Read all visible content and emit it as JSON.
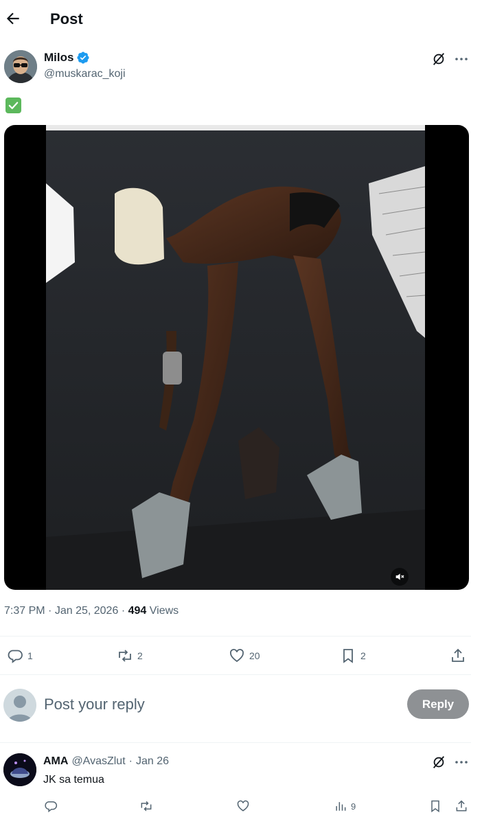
{
  "header": {
    "title": "Post"
  },
  "author": {
    "name": "Milos",
    "handle": "@muskarac_koji",
    "verified": true
  },
  "post": {
    "text_emoji": "check-mark-button",
    "time": "7:37 PM",
    "separator": "·",
    "date": "Jan 25, 2026",
    "views_count": "494",
    "views_label": "Views",
    "media": {
      "type": "video",
      "muted": true
    }
  },
  "actions": {
    "replies": "1",
    "reposts": "2",
    "likes": "20",
    "bookmarks": "2"
  },
  "composer": {
    "placeholder": "Post your reply",
    "button_label": "Reply"
  },
  "reply": {
    "name": "AMA",
    "handle": "@AvasZlut",
    "separator": "·",
    "date": "Jan 26",
    "text": "JK sa temua",
    "views": "9"
  },
  "colors": {
    "text": "#0f1419",
    "secondary": "#536471",
    "verified": "#1d9bf0",
    "divider": "#eff3f4",
    "reply_button": "#8e9194"
  }
}
